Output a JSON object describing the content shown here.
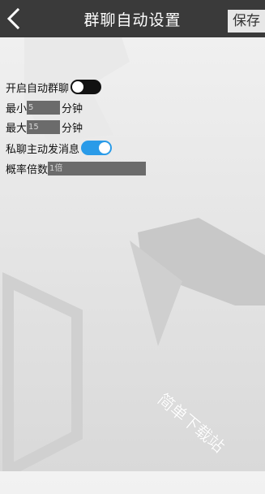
{
  "header": {
    "title": "群聊自动设置",
    "save_label": "保存"
  },
  "settings": {
    "auto_group_chat": {
      "label": "开启自动群聊",
      "enabled": false
    },
    "min": {
      "label": "最小",
      "value": "5",
      "unit": "分钟"
    },
    "max": {
      "label": "最大",
      "value": "15",
      "unit": "分钟"
    },
    "private_chat": {
      "label": "私聊主动发消息",
      "enabled": true
    },
    "multiplier": {
      "label": "概率倍数",
      "value": "1倍"
    }
  },
  "watermark": "简单下载站",
  "colors": {
    "header_bg": "#3a3a3a",
    "toggle_on": "#2a9be8",
    "toggle_off": "#111111",
    "field_bg": "#6b6b6b"
  }
}
